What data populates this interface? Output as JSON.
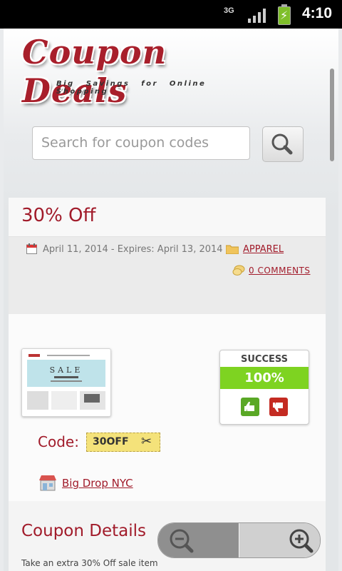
{
  "status_bar": {
    "network": "3G",
    "time": "4:10"
  },
  "brand": {
    "name": "Coupon Deals",
    "tagline": "Big Savings for Online Shopping"
  },
  "search": {
    "placeholder": "Search for coupon codes"
  },
  "coupon": {
    "title": "30% Off",
    "date_text": "April 11, 2014 - Expires: April 13, 2014",
    "category": "APPAREL",
    "comments": "0 COMMENTS",
    "vote_label": "SUCCESS",
    "success_rate": "100%",
    "code_label": "Code:",
    "code": "30OFF",
    "store": "Big Drop NYC",
    "thumb_text": "SALE",
    "details_title": "Coupon Details",
    "details_text": "Take an extra 30% Off sale item"
  },
  "colors": {
    "accent": "#a11b2a",
    "success": "#7ed321",
    "vote_up": "#5aa826",
    "vote_down": "#c42b22",
    "code_bg": "#f4e27a"
  },
  "icons": [
    "calendar-icon",
    "folder-icon",
    "comment-icon",
    "thumbs-up-icon",
    "thumbs-down-icon",
    "scissors-icon",
    "store-icon",
    "search-icon",
    "zoom-out-icon",
    "zoom-in-icon"
  ]
}
